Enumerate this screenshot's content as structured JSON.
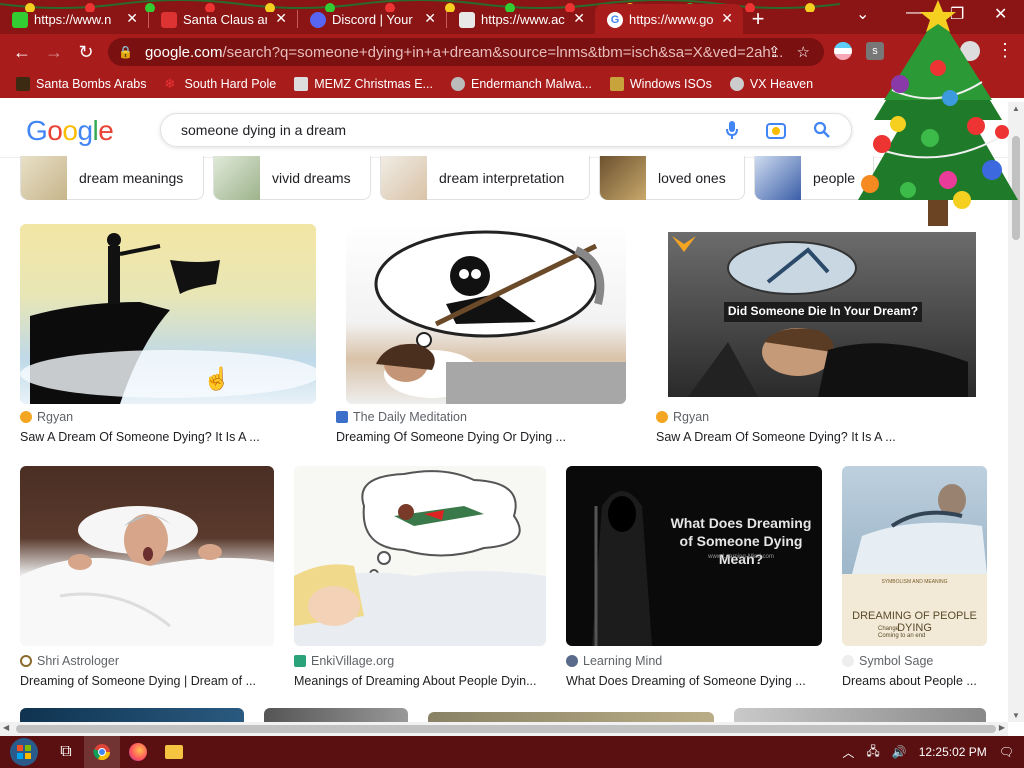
{
  "browser": {
    "tabs": [
      {
        "label": "https://www.n",
        "icon": "chrome-tab-icon",
        "active": false
      },
      {
        "label": "Santa Claus an",
        "icon": "santa-tab-icon",
        "active": false
      },
      {
        "label": "Discord | Your P",
        "icon": "discord-icon",
        "active": false
      },
      {
        "label": "https://www.ac",
        "icon": "web-tab-icon",
        "active": false
      },
      {
        "label": "https://www.goo",
        "icon": "google-icon",
        "active": true
      }
    ],
    "new_tab": "+",
    "window_controls": {
      "dropdown": "⌄",
      "minimize": "—",
      "restore": "❐",
      "close": "✕"
    },
    "url_domain": "google.com",
    "url_path": "/search?q=someone+dying+in+a+dream&source=lnms&tbm=isch&sa=X&ved=2ah...",
    "bookmarks": [
      {
        "label": "Santa Bombs Arabs",
        "icon": "bookmark-icon",
        "color": "#3d2a12"
      },
      {
        "label": "South Hard Pole",
        "icon": "snowflake-icon",
        "color": "#d22"
      },
      {
        "label": "MEMZ Christmas E...",
        "icon": "bookmark-icon",
        "color": "#ddd"
      },
      {
        "label": "Endermanch Malwa...",
        "icon": "cat-icon",
        "color": "#bbb"
      },
      {
        "label": "Windows ISOs",
        "icon": "windows-icon",
        "color": "#c8a23a"
      },
      {
        "label": "VX Heaven",
        "icon": "vx-icon",
        "color": "#ccc"
      }
    ]
  },
  "search": {
    "logo_letters": [
      "G",
      "o",
      "o",
      "g",
      "l",
      "e"
    ],
    "query": "someone dying in a dream"
  },
  "chips": [
    {
      "label": "dream meanings"
    },
    {
      "label": "vivid dreams"
    },
    {
      "label": "dream interpretation"
    },
    {
      "label": "loved ones"
    },
    {
      "label": "people"
    }
  ],
  "results": [
    {
      "source": "Rgyan",
      "title": "Saw A Dream Of Someone Dying? It Is A ...",
      "icon_color": "#f4a623"
    },
    {
      "source": "The Daily Meditation",
      "title": "Dreaming Of Someone Dying Or Dying ...",
      "icon_color": "#3b6fc9"
    },
    {
      "source": "Rgyan",
      "title": "Saw A Dream Of Someone Dying? It Is A ...",
      "icon_color": "#f4a623",
      "overlay": "Did Someone Die In Your Dream?"
    },
    {
      "source": "Shri Astrologer",
      "title": "Dreaming of Someone Dying | Dream of ...",
      "icon_color": "#8a6b2c"
    },
    {
      "source": "EnkiVillage.org",
      "title": "Meanings of Dreaming About People Dyin...",
      "icon_color": "#2aa37a"
    },
    {
      "source": "Learning Mind",
      "title": "What Does Dreaming of Someone Dying ...",
      "icon_color": "#5a6a8a",
      "overlay": "What Does Dreaming of Someone Dying Mean?",
      "overlay_small": "www.Learning-Mind.com"
    },
    {
      "source": "Symbol Sage",
      "title": "Dreams about People ...",
      "icon_color": "#eee",
      "overlay": "DREAMING OF PEOPLE DYING",
      "overlay_small": "SYMBOLISM AND MEANING",
      "bullets": [
        "Change",
        "Coming to an end"
      ]
    }
  ],
  "taskbar": {
    "clock": "12:25:02 PM"
  }
}
